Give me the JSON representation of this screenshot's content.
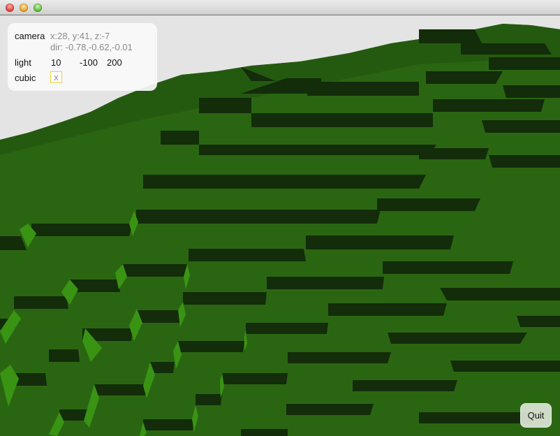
{
  "window": {
    "controls": [
      "close",
      "minimize",
      "maximize"
    ]
  },
  "info_panel": {
    "camera_label": "camera",
    "camera_position": "x:28, y:41, z:-7",
    "camera_direction": "dir: -0.78,-0.62,-0.01",
    "light_label": "light",
    "light_x": "10",
    "light_y": "-100",
    "light_z": "200",
    "cubic_label": "cubic",
    "cubic_value": "x"
  },
  "quit_button": {
    "label": "Quit"
  },
  "scene": {
    "sky_color": "#e4e4e4",
    "terrain_top_color": "#2a6612",
    "terrain_far_color": "#245a10",
    "terrain_shadow_color": "#132c0a",
    "terrain_lit_side_color": "#3a9414"
  }
}
